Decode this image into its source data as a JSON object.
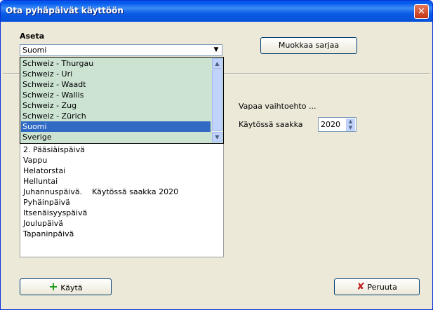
{
  "window": {
    "title": "Ota pyhäpäivät käyttöön",
    "close_icon": "close-icon"
  },
  "aseta": {
    "label": "Aseta",
    "selected": "Suomi",
    "dropdown_items": [
      "Schweiz - Thurgau",
      "Schweiz - Uri",
      "Schweiz - Waadt",
      "Schweiz - Wallis",
      "Schweiz - Zug",
      "Schweiz - Zürich",
      "Suomi",
      "Sverige"
    ],
    "highlighted_index": 6
  },
  "buttons": {
    "muokkaa": "Muokkaa sarjaa",
    "kayta": "Käytä",
    "peruuta": "Peruuta"
  },
  "right_panel": {
    "vapaa": "Vapaa vaihtoehto ...",
    "kaytossa_label": "Käytössä saakka",
    "kaytossa_value": "2020"
  },
  "holidays": [
    "2. Pääsiäispäivä",
    "Vappu",
    "Helatorstai",
    "Helluntai",
    "Juhannuspäivä.    Käytössä saakka 2020",
    "Pyhäinpäivä",
    "Itsenäisyyspäivä",
    "Joulupäivä",
    "Tapaninpäivä"
  ],
  "colors": {
    "titlebar": "#0a5ce6",
    "dropdown_bg": "#cce3d2",
    "selection": "#316ac5",
    "face": "#ece9d8"
  }
}
